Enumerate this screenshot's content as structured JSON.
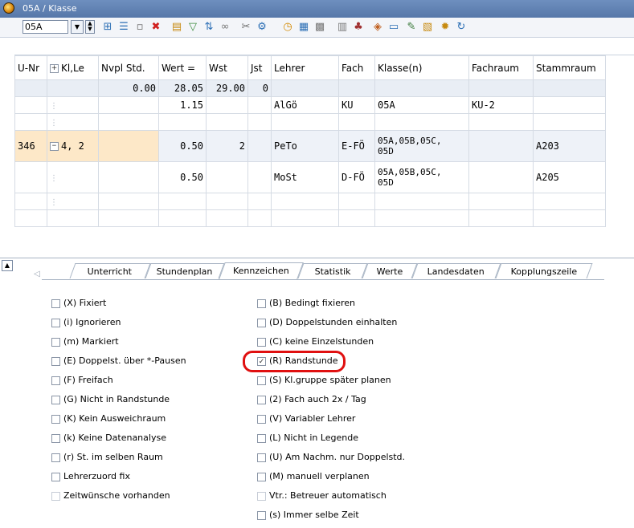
{
  "window": {
    "title": "05A / Klasse"
  },
  "toolbar": {
    "class_value": "05A"
  },
  "grid": {
    "columns": [
      "U-Nr",
      "Kl,Le",
      "Nvpl Std.",
      "Wert =",
      "Wst",
      "Jst",
      "Lehrer",
      "Fach",
      "Klasse(n)",
      "Fachraum",
      "Stammraum"
    ],
    "sum_row": {
      "nvpl": "0.00",
      "wert": "28.05",
      "wst": "29.00",
      "jst": "0"
    },
    "row1": {
      "wert": "1.15",
      "lehrer": "AlGö",
      "fach": "KU",
      "klasse": "05A",
      "fachraum": "KU-2"
    },
    "row_sel": {
      "unr": "346",
      "kl": "4, 2",
      "wert": "0.50",
      "wst": "2",
      "lehrer": "PeTo",
      "fach": "E-FÖ",
      "klasse_a": "05A,05B,05C,",
      "klasse_b": "05D",
      "stammraum": "A203"
    },
    "row_sub": {
      "wert": "0.50",
      "lehrer": "MoSt",
      "fach": "D-FÖ",
      "klasse_a": "05A,05B,05C,",
      "klasse_b": "05D",
      "stammraum": "A205"
    }
  },
  "tabs": [
    "Unterricht",
    "Stundenplan",
    "Kennzeichen",
    "Statistik",
    "Werte",
    "Landesdaten",
    "Kopplungszeile"
  ],
  "active_tab": "Kennzeichen",
  "flags_left": [
    "(X) Fixiert",
    "(i) Ignorieren",
    "(m) Markiert",
    "(E) Doppelst. über *-Pausen",
    "(F) Freifach",
    "(G) Nicht in Randstunde",
    "(K) Kein Ausweichraum",
    "(k) Keine Datenanalyse",
    "(r) St. im selben Raum",
    "Lehrerzuord fix",
    "Zeitwünsche vorhanden"
  ],
  "flags_right": [
    "(B) Bedingt fixieren",
    "(D) Doppelstunden einhalten",
    "(C) keine Einzelstunden",
    "(R) Randstunde",
    "(S) Kl.gruppe später planen",
    "(2) Fach auch 2x / Tag",
    "(V) Variabler Lehrer",
    "(L) Nicht in Legende",
    "(U) Am Nachm. nur Doppelstd.",
    "(M) manuell verplanen",
    "Vtr.: Betreuer automatisch",
    "(s) Immer selbe Zeit"
  ],
  "checked_flag": "(R) Randstunde",
  "colors": {
    "title_bar": "#5a7bb0",
    "selected_cell": "#fde8c8",
    "highlight": "#e01010"
  }
}
